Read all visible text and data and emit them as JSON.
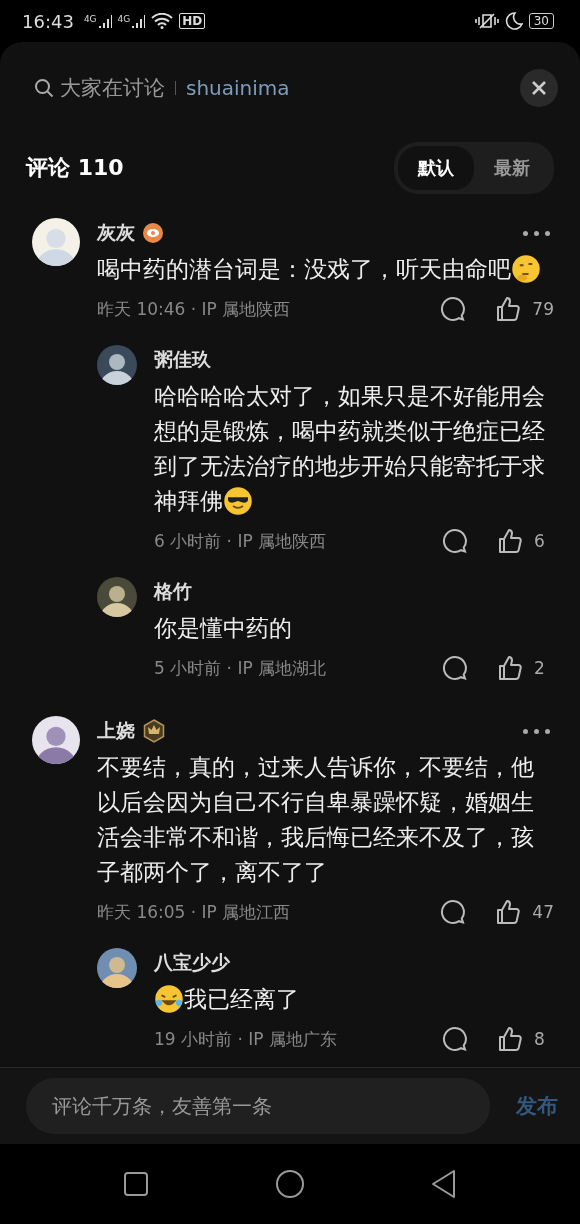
{
  "status_bar": {
    "time": "16:43",
    "signals": [
      {
        "label": "4G"
      },
      {
        "label": "4G"
      }
    ],
    "hd_label": "HD",
    "battery": "30"
  },
  "search": {
    "placeholder": "大家在讨论",
    "query": "shuainima"
  },
  "header": {
    "title": "评论 110",
    "tabs": [
      {
        "label": "默认",
        "selected": true
      },
      {
        "label": "最新",
        "selected": false
      }
    ]
  },
  "comments": [
    {
      "name": "灰灰",
      "badge": {
        "kind": "eye"
      },
      "parts": [
        {
          "kind": "text",
          "text": "喝中药的潜台词是：没戏了，听天由命吧"
        },
        {
          "kind": "thinking-emoji"
        }
      ],
      "meta": "昨天 10:46 · IP 属地陕西",
      "likes": "79",
      "replies": [
        {
          "name": "粥佳玖",
          "parts": [
            {
              "kind": "text",
              "text": "哈哈哈哈太对了，如果只是不好能用会想的是锻炼，喝中药就类似于绝症已经到了无法治疗的地步开始只能寄托于求神拜佛"
            },
            {
              "kind": "cool-emoji"
            }
          ],
          "meta": "6 小时前 · IP 属地陕西",
          "likes": "6"
        },
        {
          "name": "格竹",
          "parts": [
            {
              "kind": "text",
              "text": "你是懂中药的"
            }
          ],
          "meta": "5 小时前 · IP 属地湖北",
          "likes": "2"
        }
      ]
    },
    {
      "name": "上娆",
      "badge": {
        "kind": "crown"
      },
      "parts": [
        {
          "kind": "text",
          "text": "不要结，真的，过来人告诉你，不要结，他以后会因为自己不行自卑暴躁怀疑，婚姻生活会非常不和谐，我后悔已经来不及了，孩子都两个了，离不了了"
        }
      ],
      "meta": "昨天 16:05 · IP 属地江西",
      "likes": "47",
      "replies": [
        {
          "name": "八宝少少",
          "parts": [
            {
              "kind": "laughing-emoji"
            },
            {
              "kind": "text",
              "text": "我已经离了"
            }
          ],
          "meta": "19 小时前 · IP 属地广东",
          "likes": "8"
        }
      ]
    }
  ],
  "composer": {
    "placeholder": "评论千万条，友善第一条",
    "send": "发布"
  }
}
